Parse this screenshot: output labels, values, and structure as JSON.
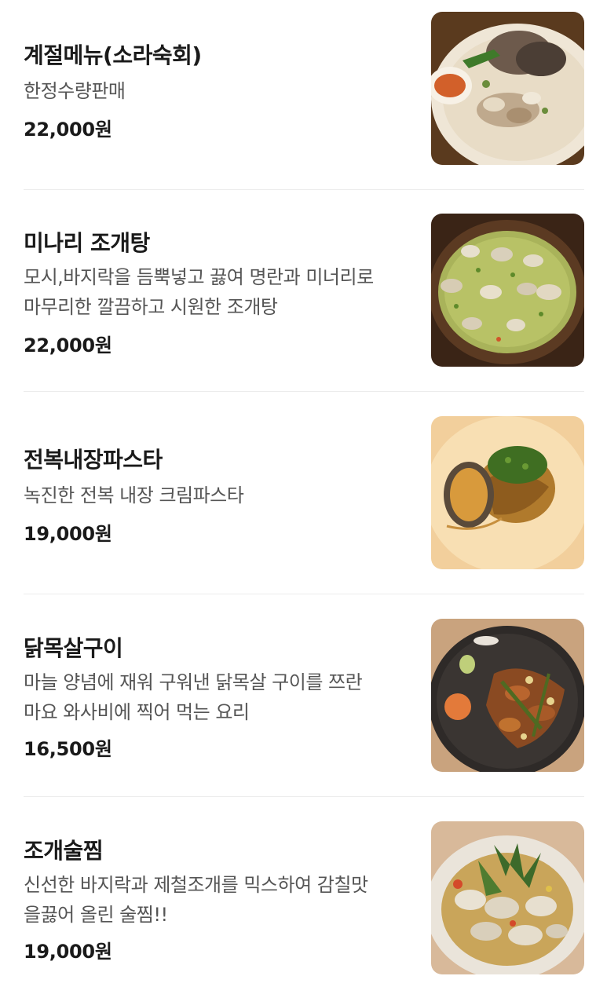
{
  "menu": {
    "items": [
      {
        "name": "계절메뉴(소라숙회)",
        "description": "한정수량판매",
        "price": "22,000원",
        "photo_icon": "sea-snail-dish-photo"
      },
      {
        "name": "미나리 조개탕",
        "description": "모시,바지락을 듬뿍넣고 끓여 명란과 미너리로\n마무리한 깔끔하고 시원한 조개탕",
        "price": "22,000원",
        "photo_icon": "clam-soup-photo"
      },
      {
        "name": "전복내장파스타",
        "description": "녹진한 전복 내장 크림파스타",
        "price": "19,000원",
        "photo_icon": "abalone-pasta-photo"
      },
      {
        "name": "닭목살구이",
        "description": "마늘 양념에 재워 구워낸 닭목살 구이를 쯔란\n마요 와사비에 찍어 먹는 요리",
        "price": "16,500원",
        "photo_icon": "grilled-chicken-neck-photo"
      },
      {
        "name": "조개술찜",
        "description": "신선한 바지락과 제철조개를 믹스하여 감칠맛\n을끓어 올린 술찜!!",
        "price": "19,000원",
        "photo_icon": "steamed-clams-photo"
      }
    ]
  },
  "colors": {
    "text_primary": "#1a1a1a",
    "text_secondary": "#555555",
    "divider": "#ececec",
    "background": "#ffffff"
  }
}
